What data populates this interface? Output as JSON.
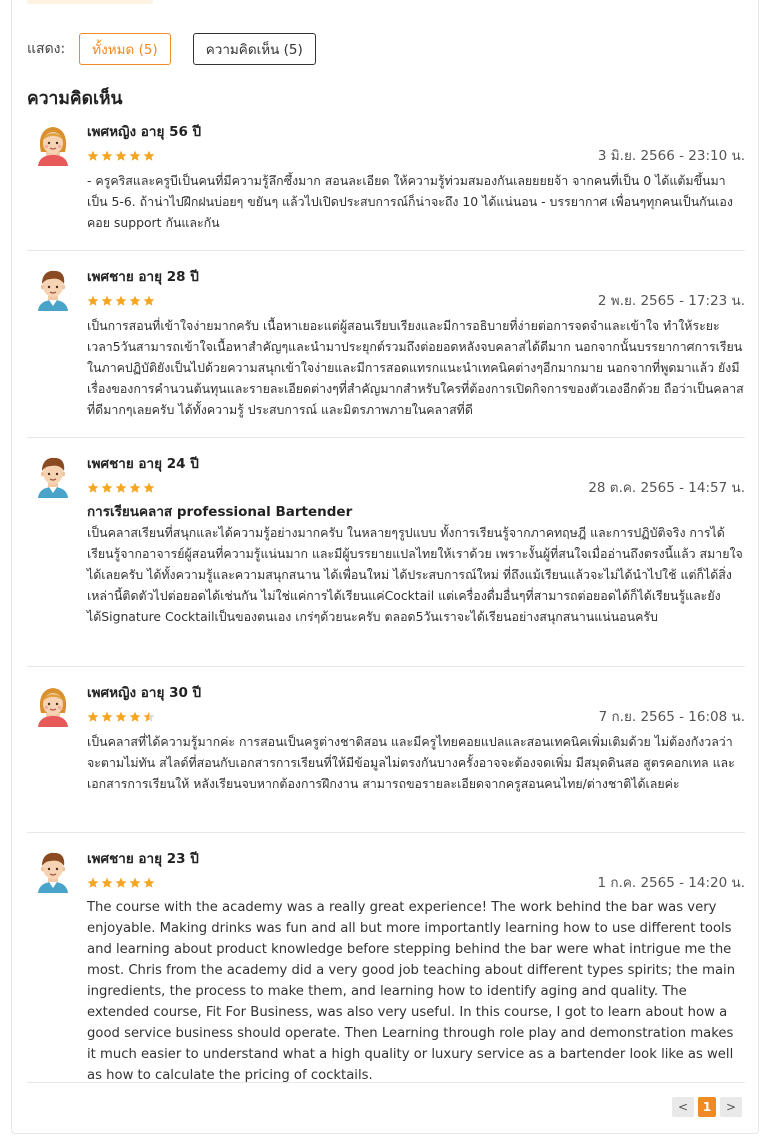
{
  "filter": {
    "label": "แสดง:",
    "all_tab": "ทั้งหมด (5)",
    "comments_tab": "ความคิดเห็น (5)"
  },
  "section_title": "ความคิดเห็น",
  "reviews": [
    {
      "name": "เพศหญิง อายุ 56 ปี",
      "avatar": "female-avatar-icon",
      "rating": 5,
      "date": "3 มิ.ย. 2566 - 23:10 น.",
      "heading": "",
      "text": "- ครูคริสและครูบีเป็นคนที่มีความรู้ลึกซึ้งมาก สอนละเอียด ให้ความรู้ท่วมสมองกันเลยยยยจ้า จากคนที่เป็น 0 ได้แต้มขึ้นมาเป็น 5-6. ถ้าน่าไปฝึกฝนบ่อยๆ ขยันๆ แล้วไปเปิดประสบการณ์ก็น่าจะถึง 10 ได้แน่นอน - บรรยากาศ เพื่อนๆทุกคนเป็นกันเอง คอย support กันและกัน"
    },
    {
      "name": "เพศชาย อายุ 28 ปี",
      "avatar": "male-avatar-icon",
      "rating": 5,
      "date": "2 พ.ย. 2565 - 17:23 น.",
      "heading": "",
      "text": "เป็นการสอนที่เข้าใจง่ายมากครับ เนื้อหาเยอะแต่ผู้สอนเรียบเรียงและมีการอธิบายที่ง่ายต่อการจดจำและเข้าใจ ทำให้ระยะเวลา5วันสามารถเข้าใจเนื้อหาสำคัญๆและนำมาประยุกต์รวมถึงต่อยอดหลังจบคลาสได้ดีมาก นอกจากนั้นบรรยากาศการเรียนในภาคปฏิบัติยังเป็นไปด้วยความสนุกเข้าใจง่ายและมีการสอดแทรกแนะนำเทคนิคต่างๆอีกมากมาย นอกจากที่พูดมาแล้ว ยังมีเรื่องของการคำนวนต้นทุนและรายละเอียดต่างๆที่สำคัญมากสำหรับใครที่ต้องการเปิดกิจการของตัวเองอีกด้วย ถือว่าเป็นคลาสที่ดีมากๆเลยครับ ได้ทั้งความรู้ ประสบการณ์ และมิตรภาพภายในคลาสที่ดี"
    },
    {
      "name": "เพศชาย อายุ 24 ปี",
      "avatar": "male-avatar-icon",
      "rating": 5,
      "date": "28 ต.ค. 2565 - 14:57 น.",
      "heading": "การเรียนคลาส professional Bartender",
      "text": "เป็นคลาสเรียนที่สนุกและได้ความรู้อย่างมากครับ ในหลายๆรูปแบบ ทั้งการเรียนรู้จากภาคทฤษฎี และการปฏิบัติจริง การได้เรียนรู้จากอาจารย์ผู้สอนที่ความรู้แน่นมาก และมีผู้บรรยายแปลไทยให้เราด้วย เพราะงั้นผู้ที่สนใจเมื่ออ่านถึงตรงนี้แล้ว สมายใจได้เลยครับ ได้ทั้งความรู้และความสนุกสนาน ได้เพื่อนใหม่ ได้ประสบการณ์ใหม่ ที่ถึงแม้เรียนแล้วจะไม่ได้นำไปใช้ แต่ก็ได้สิ่งเหล่านี้ติดตัวไปต่อยอดได้เช่นกัน ไม่ใช่แค่การได้เรียนแค่Cocktail แต่เครื่องดื่มอื่นๆที่สามารถต่อยอดได้ก็ได้เรียนรู้และยังได้Signature Cocktailเป็นของตนเอง เกร่ๆด้วยนะครับ ตลอด5วันเราจะได้เรียนอย่างสนุกสนานแน่นอนครับ"
    },
    {
      "name": "เพศหญิง อายุ 30 ปี",
      "avatar": "female-avatar-icon",
      "rating": 4.5,
      "date": "7 ก.ย. 2565 - 16:08 น.",
      "heading": "",
      "text": "เป็นคลาสที่ได้ความรู้มากค่ะ การสอนเป็นครูต่างชาติสอน และมีครูไทยคอยแปลและสอนเทคนิคเพิ่มเติมด้วย ไม่ต้องกังวลว่าจะตามไม่ทัน สไลด์ที่สอนกับเอกสารการเรียนที่ให้มีข้อมูลไม่ตรงกันบางครั้งอาจจะต้องจดเพิ่ม มีสมุดดินสอ สูตรคอกเทล และเอกสารการเรียนให้ หลังเรียนจบหากต้องการฝึกงาน สามารถขอรายละเอียดจากครูสอนคนไทย/ต่างชาติได้เลยค่ะ"
    },
    {
      "name": "เพศชาย อายุ 23 ปี",
      "avatar": "male-avatar-icon",
      "rating": 5,
      "date": "1 ก.ค. 2565 - 14:20 น.",
      "heading": "",
      "text": "The course with the academy was a really great experience! The work behind the bar was very enjoyable. Making drinks was fun and all but more importantly learning how to use different tools and learning about product knowledge before stepping behind the bar were what intrigue me the most. Chris from the academy did a very good job teaching about different types spirits; the main ingredients, the process to make them, and learning how to identify aging and quality. The extended course, Fit For Business, was also very useful. In this course, I got to learn about how a good service business should operate. Then Learning through role play and demonstration makes it much easier to understand what a high quality or luxury service as a bartender look like as well as how to calculate the pricing of cocktails."
    }
  ],
  "pagination": {
    "prev": "<",
    "current": "1",
    "next": ">"
  },
  "colors": {
    "accent": "#f08a24",
    "star": "#f5a623",
    "star_empty": "#d8d8d8"
  }
}
